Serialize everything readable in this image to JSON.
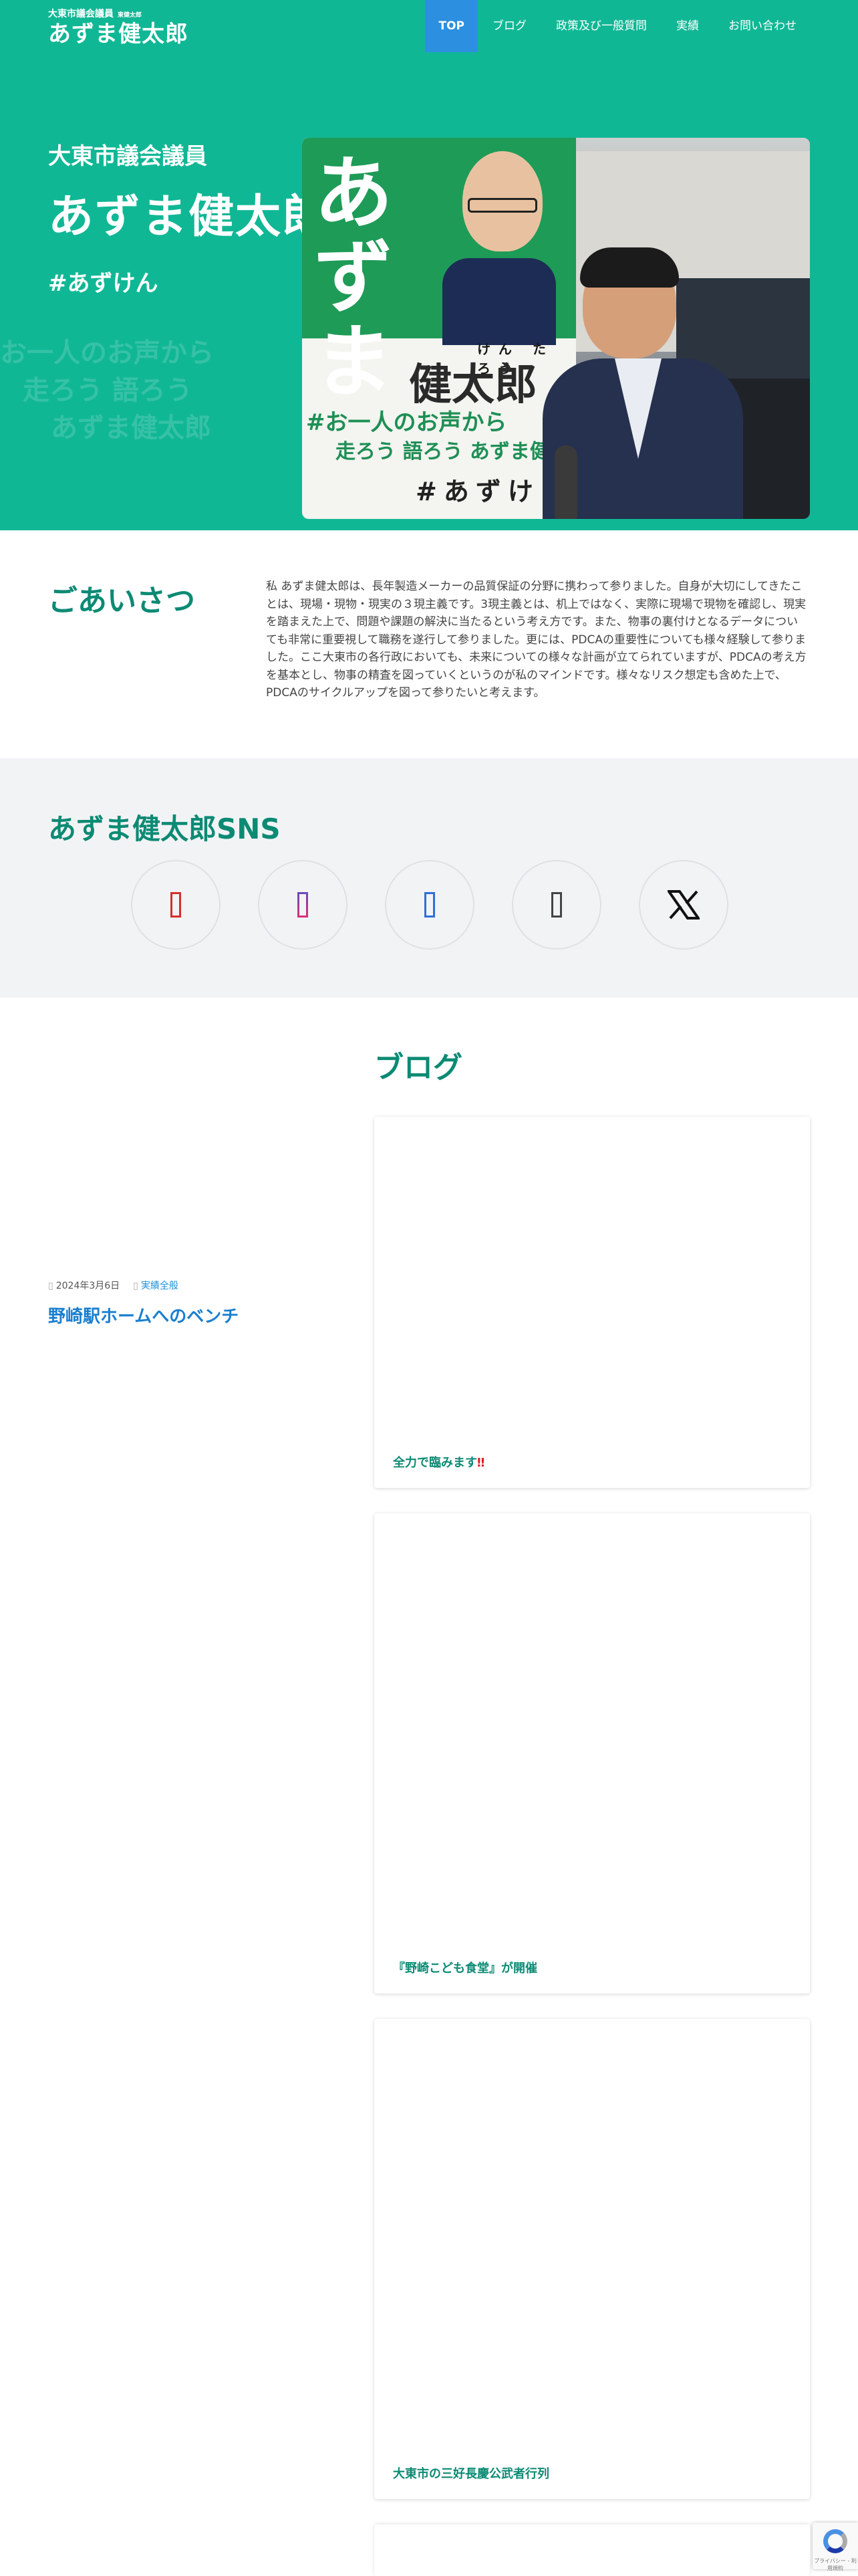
{
  "header": {
    "logo_sub": "大東市議会議員",
    "logo_mini": "東健太郎",
    "logo_main": "あずま健太郎",
    "nav": [
      {
        "label": "TOP",
        "active": true
      },
      {
        "label": "ブログ"
      },
      {
        "label": "政策及び一般質問"
      },
      {
        "label": "実績"
      },
      {
        "label": "お問い合わせ"
      }
    ]
  },
  "hero": {
    "role": "大東市議会議員",
    "name": "あずま健太郎",
    "tag": "#あずけん",
    "ghost_lines": [
      "お一人のお声から",
      "走ろう 語ろう",
      "あずま健太郎"
    ],
    "banner_vertical": "あずま",
    "banner_furigana": "けん た ろう",
    "banner_kanji": "健太郎",
    "banner_slogan1": "#お一人のお声から",
    "banner_slogan2": "走ろう 語ろう あずま健太郎",
    "banner_hashtag": "#あずけ"
  },
  "greeting": {
    "title": "ごあいさつ",
    "text": "私 あずま健太郎は、長年製造メーカーの品質保証の分野に携わって参りました。自身が大切にしてきたことは、現場・現物・現実の３現主義です。3現主義とは、机上ではなく、実際に現場で現物を確認し、現実を踏まえた上で、問題や課題の解決に当たるという考え方です。また、物事の裏付けとなるデータについても非常に重要視して職務を遂行して参りました。更には、PDCAの重要性についても様々経験して参りました。ここ大東市の各行政においても、未来についての様々な計画が立てられていますが、PDCAの考え方を基本とし、物事の精査を図っていくというのが私のマインドです。様々なリスク想定も含めた上で、PDCAのサイクルアップを図って参りたいと考えます。"
  },
  "sns": {
    "title": "あずま健太郎SNS",
    "icons": [
      "youtube-icon",
      "instagram-icon",
      "facebook-icon",
      "tiktok-icon",
      "x-icon"
    ]
  },
  "blog": {
    "title": "ブログ",
    "featured": {
      "date": "2024年3月6日",
      "category": "実績全般",
      "title": "野崎駅ホームへのベンチ"
    },
    "cards": [
      {
        "title": "全力で臨みます",
        "suffix": "‼"
      },
      {
        "title": "『野崎こども食堂』が開催",
        "suffix": ""
      },
      {
        "title": "大東市の三好長慶公武者行列",
        "suffix": ""
      }
    ]
  },
  "recaptcha": {
    "label": "プライバシー - 利用規約"
  }
}
